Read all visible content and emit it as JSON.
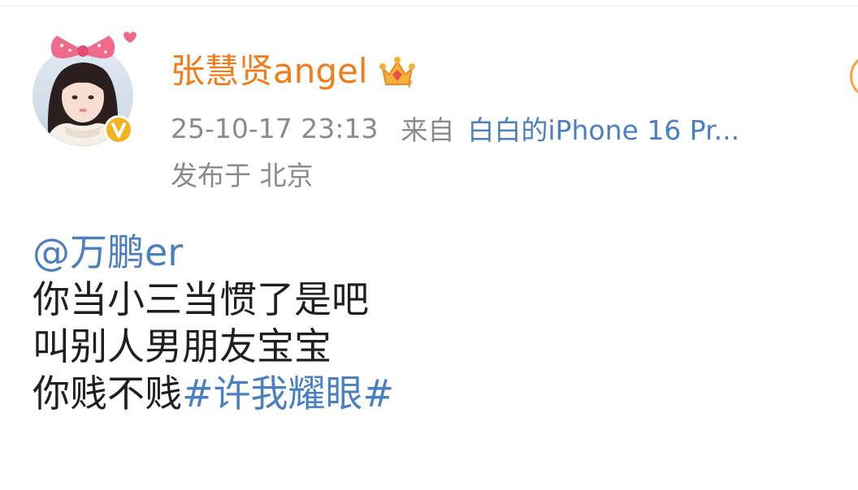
{
  "post": {
    "author": {
      "name": "张慧贤angel",
      "verified_badge": "v-badge-icon",
      "member_icon": "crown-icon",
      "colors": {
        "name": "#f07c1a",
        "badge": "#f5b31b"
      }
    },
    "meta": {
      "timestamp": "25-10-17 23:13",
      "from_label": "来自",
      "device": "白白的iPhone 16 Pr...",
      "location": "发布于 北京"
    },
    "content": {
      "mention": "@万鹏er",
      "line2": "你当小三当惯了是吧",
      "line3": "叫别人男朋友宝宝",
      "line4_text": "你贱不贱",
      "hashtag": "#许我耀眼#"
    },
    "colors": {
      "link": "#4a7fc1",
      "meta": "#8a8a8a",
      "body": "#1f1f1f"
    }
  }
}
